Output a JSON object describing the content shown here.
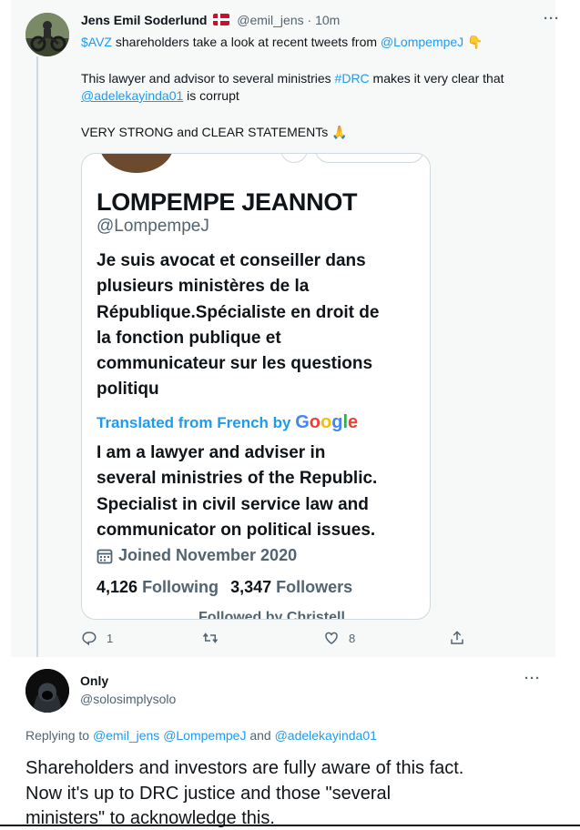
{
  "tweet1": {
    "author_name": "Jens Emil Soderlund",
    "flag_icon": "denmark-flag-icon",
    "handle": "@emil_jens",
    "separator": "·",
    "time": "10m",
    "line1_cashtag": "$AVZ",
    "line1_text": " shareholders take a look at recent tweets from ",
    "line1_mention": "@LompempeJ",
    "line1_emoji": "👇",
    "line2_text": "This lawyer and advisor to several ministries ",
    "line2_hashtag": "#DRC",
    "line2_tail": " makes it very clear that",
    "line3_mention": "@adelekayinda01",
    "line3_text": " is corrupt",
    "line4_text": "VERY STRONG and CLEAR STATEMENTs",
    "line4_emoji": "🙏",
    "more_label": "···",
    "actions": {
      "reply_count": "1",
      "retweet_count": "",
      "like_count": "8"
    }
  },
  "card": {
    "name": "LOMPEMPE JEANNOT",
    "handle": "@LompempeJ",
    "bio_lines": [
      "Je suis avocat et conseiller dans",
      "plusieurs ministères de la",
      "République.Spécialiste en droit de",
      "la fonction publique et",
      "communicateur sur les questions",
      "politiqu"
    ],
    "translated_label": "Translated from French by",
    "google": "Google",
    "translated_lines": [
      "I am a lawyer and adviser in",
      "several ministries of the Republic.",
      "Specialist in civil service law and",
      "communicator on political issues."
    ],
    "joined": "Joined November 2020",
    "following_count": "4,126",
    "following_label": "Following",
    "followers_count": "3,347",
    "followers_label": "Followers",
    "footer_partial": "Followed by Christell"
  },
  "tweet2": {
    "author_name": "Only",
    "handle": "@solosimplysolo",
    "more_label": "···",
    "replying_prefix": "Replying to ",
    "replying_to_1": "@emil_jens",
    "replying_to_2": "@LompempeJ",
    "replying_and": " and ",
    "replying_to_3": "@adelekayinda01",
    "body_lines": [
      "Shareholders and investors are fully aware of this fact.",
      "Now it's up to DRC justice and those \"several",
      "ministers\" to acknowledge this."
    ]
  },
  "colors": {
    "link": "#1d9bf0",
    "muted": "#536471",
    "text": "#0f1419",
    "tweet_bg": "#f7f9f9",
    "border": "#cfd9de"
  }
}
